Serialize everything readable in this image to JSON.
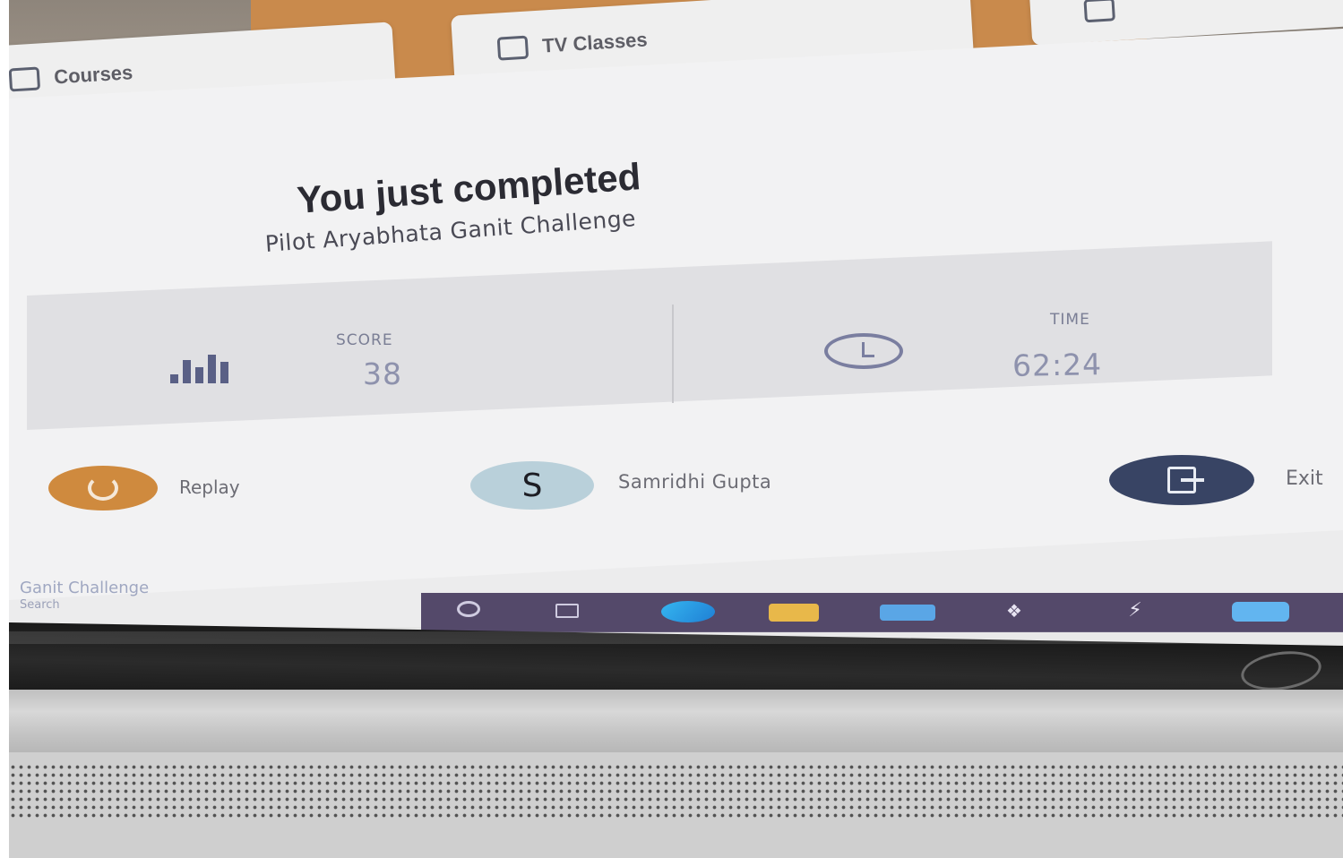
{
  "tabs": [
    {
      "label": "Courses",
      "icon": "graduation-cap-icon"
    },
    {
      "label": "TV Classes",
      "icon": "tv-icon"
    }
  ],
  "result": {
    "headline": "You just completed",
    "challenge_name": "Pilot Aryabhata Ganit Challenge"
  },
  "stats": {
    "score_label": "SCORE",
    "score_value": "38",
    "time_label": "TIME",
    "time_value": "62:24"
  },
  "actions": {
    "replay_label": "Replay",
    "avatar_initial": "S",
    "user_name": "Samridhi Gupta",
    "exit_label": "Exit"
  },
  "footer": {
    "link_text": "Ganit Challenge",
    "search_text": "Search"
  },
  "colors": {
    "accent_orange": "#cf8a3e",
    "exit_navy": "#384464",
    "avatar_blue": "#b9d0da",
    "taskbar": "#54496a"
  }
}
